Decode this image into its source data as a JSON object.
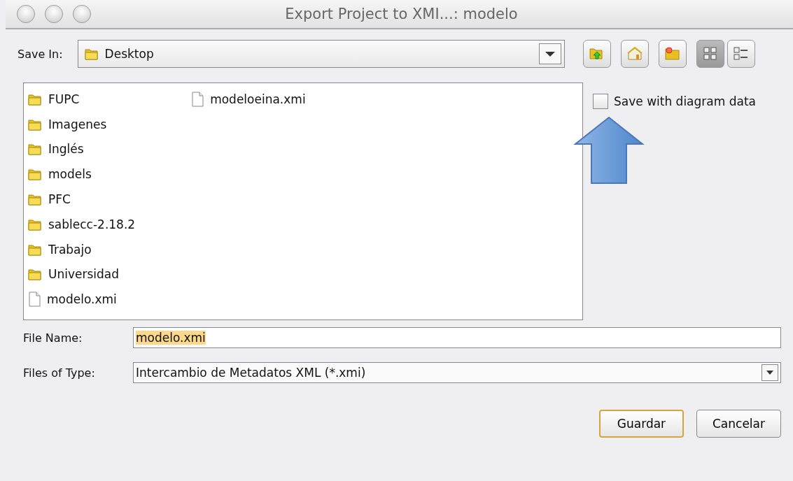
{
  "window": {
    "title": "Export Project to XMI...: modelo"
  },
  "save_in": {
    "label": "Save In:",
    "value": "Desktop"
  },
  "toolbar_buttons": [
    {
      "kind": "up",
      "pressed": false
    },
    {
      "kind": "home",
      "pressed": false
    },
    {
      "kind": "newfolder",
      "pressed": false
    },
    {
      "kind": "list",
      "pressed": true
    },
    {
      "kind": "details",
      "pressed": false
    }
  ],
  "files": [
    {
      "name": "FUPC",
      "kind": "folder",
      "selected": false
    },
    {
      "name": "Imagenes",
      "kind": "folder",
      "selected": false
    },
    {
      "name": "Inglés",
      "kind": "folder",
      "selected": false
    },
    {
      "name": "models",
      "kind": "folder",
      "selected": false
    },
    {
      "name": "PFC",
      "kind": "folder",
      "selected": false
    },
    {
      "name": "sablecc-2.18.2",
      "kind": "folder",
      "selected": false
    },
    {
      "name": "Trabajo",
      "kind": "folder",
      "selected": false
    },
    {
      "name": "Universidad",
      "kind": "folder",
      "selected": false
    },
    {
      "name": "modelo.xmi",
      "kind": "file",
      "selected": false
    },
    {
      "name": "modeloeina.xmi",
      "kind": "file",
      "selected": false
    }
  ],
  "save_diagram": {
    "label": "Save with diagram data",
    "checked": false
  },
  "file_name": {
    "label": "File Name:",
    "value": "modelo.xmi"
  },
  "file_type": {
    "label": "Files of Type:",
    "value": "Intercambio de Metadatos XML (*.xmi)"
  },
  "buttons": [
    {
      "label": "Guardar",
      "default": true
    },
    {
      "label": "Cancelar",
      "default": false
    }
  ]
}
